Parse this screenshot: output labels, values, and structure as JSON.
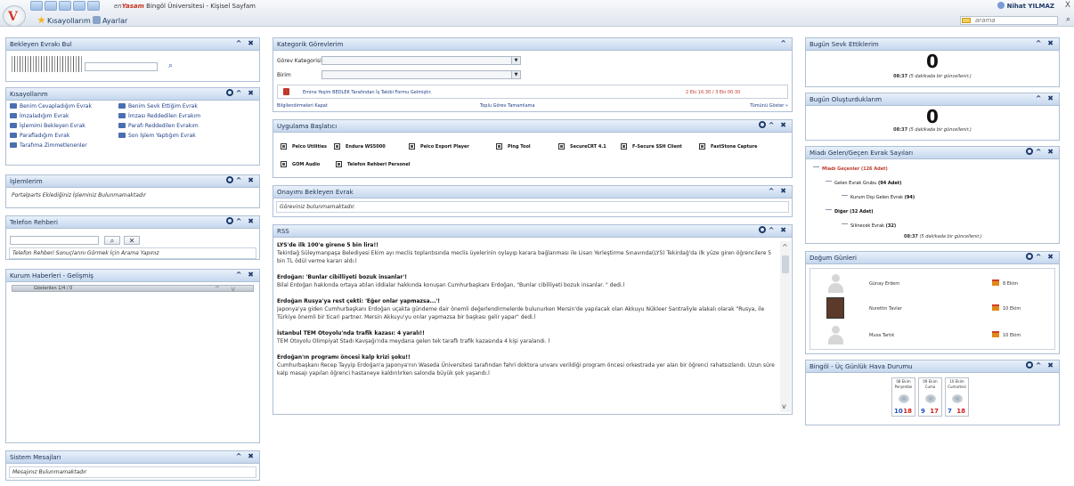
{
  "header": {
    "brand_prefix": "en",
    "brand_name": "Yasam",
    "title": "Bingöl Üniversitesi - Kişisel Sayfam",
    "nav": {
      "shortcuts": "Kısayollarım",
      "settings": "Ayarlar"
    },
    "user": "Nihat YILMAZ",
    "close": "X",
    "search_placeholder": "arama"
  },
  "panels": {
    "pending_find": {
      "title": "Bekleyen Evrakı Bul"
    },
    "shortcuts": {
      "title": "Kısayollarım",
      "items": [
        "Benim Cevapladığım Evrak",
        "Benim Sevk Ettiğim Evrak",
        "İmzaladığım Evrak",
        "İmzası Reddedilen Evrakım",
        "İşlemimi Bekleyen Evrak",
        "Parafı Reddedilen Evrakım",
        "Parafladığım Evrak",
        "Son İşlem Yaptığım Evrak",
        "Tarafıma Zimmetlenenler"
      ]
    },
    "my_actions": {
      "title": "İşlemlerim",
      "message": "Portalparts Eklediğiniz İşleminiz Bulunmamaktadır"
    },
    "phone": {
      "title": "Telefon Rehberi",
      "message": "Telefon Rehberi Sonuçlarını Görmek İçin Arama Yapınız"
    },
    "news": {
      "title": "Kurum Haberleri - Gelişmiş",
      "counter": "Gösterilen 1/4 / 0"
    },
    "system": {
      "title": "Sistem Mesajları",
      "message": "Mesajınız Bulunmamaktadır"
    },
    "tasks": {
      "title": "Kategorik Görevlerim",
      "category_label": "Görev Kategorisi",
      "unit_label": "Birim",
      "task_text": "Emine Yeşim BEDLEK Tarafından İş Takibi Formu Gelmiştir.",
      "task_date": "2 Eki 16:30 / 3 Eki 00:30",
      "footer_left": "Bilgilendirmeleri Kapat",
      "footer_mid": "Toplu Görev Tamamlama",
      "footer_right": "Tümünü Göster »"
    },
    "launcher": {
      "title": "Uygulama Başlatıcı",
      "apps": [
        "Pelco Utilities",
        "Endura WS5000",
        "Pelco Export Player",
        "Ping Tool",
        "SecureCRT 4.1",
        "F-Secure SSH Client",
        "FastStone Capture",
        "GOM Audio",
        "Telefon Rehberi Personel"
      ]
    },
    "approval": {
      "title": "Onayımı Bekleyen Evrak",
      "message": "Göreviniz bulunmamaktadır."
    },
    "rss": {
      "title": "RSS",
      "items": [
        {
          "h": "LYS'de ilk 100'e girene 5 bin lira!!",
          "b": "Tekirdağ Süleymanpaşa Belediyesi Ekim ayı meclis toplantısında meclis üyelerinin oylayıp karara bağlanması ile Lisan Yerleştirme Sınavında(LYS) Tekirdağ'da ilk yüze giren öğrencilere 5 bin TL ödül verme kararı aldı.l"
        },
        {
          "h": "Erdoğan: 'Bunlar cibilliyeti bozuk insanlar'!",
          "b": "Bilal Erdoğan hakkında ortaya atılan iddialar hakkında konuşan Cumhurbaşkanı Erdoğan, \"Bunlar cibilliyeti bozuk insanlar. \" dedi.l"
        },
        {
          "h": "Erdoğan Rusya'ya rest çekti: 'Eğer onlar yapmazsa...'!",
          "b": "Japonya'ya giden Cumhurbaşkanı Erdoğan uçakta gündeme dair önemli değerlendirmelerde bulunurken Mersin'de yapılacak olan Akkuyu Nükleer Santraliyle alakalı olarak \"Rusya, ile Türkiye önemli bir ticari partner. Mersin Akkuyu'yu onlar yapmazsa bir başkası gelir yapar\" dedi.l"
        },
        {
          "h": "İstanbul TEM Otoyolu'nda trafik kazası: 4 yaralı!!",
          "b": "TEM Otoyolu Olimpiyat Stadı Kavşağı'nda meydana gelen tek taraflı trafik kazasında 4 kişi yaralandı. l"
        },
        {
          "h": "Erdoğan'ın programı öncesi kalp krizi şoku!!",
          "b": "Cumhurbaşkanı Recep Tayyip Erdoğan'a Japonya'nın Waseda Üniversitesi tarafından fahri doktora unvanı verildiği program öncesi orkestrada yer alan bir öğrenci rahatsızlandı. Uzun süre kalp masajı yapılan öğrenci hastaneye kaldırılırken salonda büyük şok yaşandı.l"
        }
      ]
    },
    "sent_today": {
      "title": "Bugün Sevk Ettiklerim",
      "count": "0",
      "time": "08:37",
      "note": "(5 dakikada bir güncellenir.)"
    },
    "created_today": {
      "title": "Bugün Oluşturduklarım",
      "count": "0",
      "time": "08:37",
      "note": "(5 dakikada bir güncellenir.)"
    },
    "due": {
      "title": "Miadı Gelen/Geçen Evrak Sayıları",
      "root": "Miadı Geçenler (126 Adet)",
      "group": "Gelen Evrak Grubu",
      "group_count": "(94 Adet)",
      "sub1": "Kurum Dışı Gelen Evrak",
      "sub1_count": "(94)",
      "other": "Diğer",
      "other_count": "(32 Adet)",
      "sub2": "Silinecek Evrak",
      "sub2_count": "(32)",
      "time": "08:37",
      "note": "(5 dakikada bir güncellenir.)"
    },
    "birthdays": {
      "title": "Doğum Günleri",
      "people": [
        {
          "name": "Günay Erdem",
          "date": "8 Ekim"
        },
        {
          "name": "Nurettin Tavlar",
          "date": "10 Ekim"
        },
        {
          "name": "Musa Tartık",
          "date": "10 Ekim"
        }
      ]
    },
    "weather": {
      "title": "Bingöl - Üç Günlük Hava Durumu",
      "days": [
        {
          "date": "08 Ekim",
          "day": "Perşembe",
          "lo": "10",
          "hi": "18"
        },
        {
          "date": "09 Ekim",
          "day": "Cuma",
          "lo": "9",
          "hi": "17"
        },
        {
          "date": "10 Ekim",
          "day": "Cumartesi",
          "lo": "7",
          "hi": "18"
        }
      ]
    }
  }
}
